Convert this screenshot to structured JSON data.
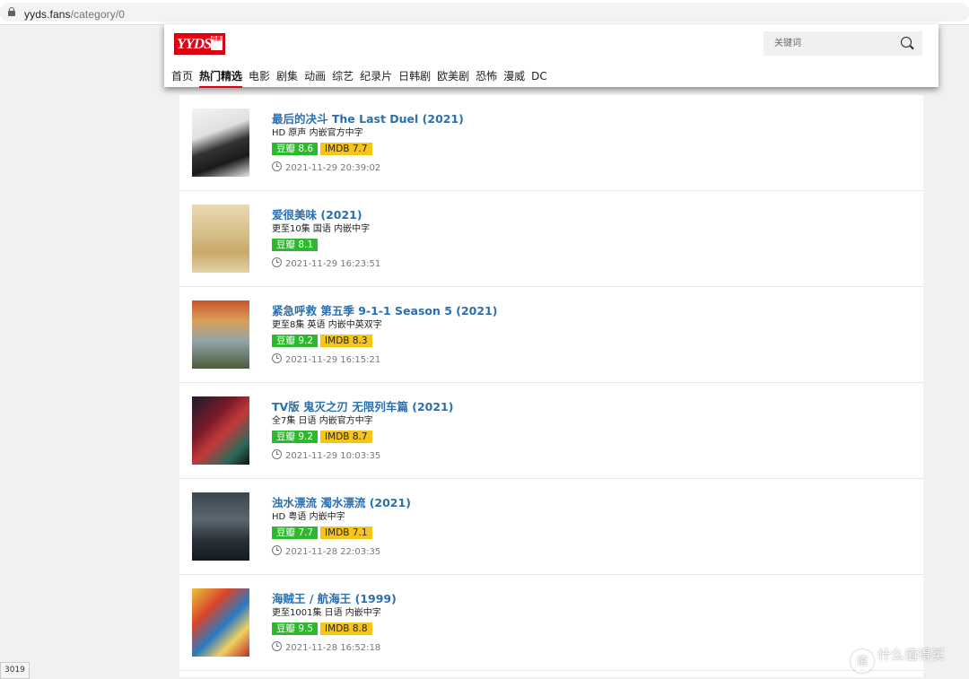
{
  "browser": {
    "url_host": "yyds.fans",
    "url_path": "/category/0"
  },
  "site": {
    "logo_text": "YYDS",
    "logo_sub": "电影",
    "search_placeholder": "关键词"
  },
  "nav": [
    {
      "label": "首页"
    },
    {
      "label": "热门精选",
      "active": true
    },
    {
      "label": "电影"
    },
    {
      "label": "剧集"
    },
    {
      "label": "动画"
    },
    {
      "label": "综艺"
    },
    {
      "label": "纪录片"
    },
    {
      "label": "日韩剧"
    },
    {
      "label": "欧美剧"
    },
    {
      "label": "恐怖"
    },
    {
      "label": "漫威"
    },
    {
      "label": "DC"
    }
  ],
  "items": [
    {
      "title": "最后的决斗 The Last Duel (2021)",
      "subtitle": "HD 原声 内嵌官方中字",
      "douban": "豆瓣 8.6",
      "imdb": "IMDB 7.7",
      "time": "2021-11-29 20:39:02"
    },
    {
      "title": "爱很美味 (2021)",
      "subtitle": "更至10集 国语 内嵌中字",
      "douban": "豆瓣 8.1",
      "imdb": null,
      "time": "2021-11-29 16:23:51"
    },
    {
      "title": "紧急呼救 第五季 9-1-1 Season 5 (2021)",
      "subtitle": "更至8集 英语 内嵌中英双字",
      "douban": "豆瓣 9.2",
      "imdb": "IMDB 8.3",
      "time": "2021-11-29 16:15:21"
    },
    {
      "title": "TV版 鬼灭之刃 无限列车篇 (2021)",
      "subtitle": "全7集 日语 内嵌官方中字",
      "douban": "豆瓣 9.2",
      "imdb": "IMDB 8.7",
      "time": "2021-11-29 10:03:35"
    },
    {
      "title": "浊水漂流 濁水漂流 (2021)",
      "subtitle": "HD 粤语 内嵌中字",
      "douban": "豆瓣 7.7",
      "imdb": "IMDB 7.1",
      "time": "2021-11-28 22:03:35"
    },
    {
      "title": "海贼王 / 航海王 (1999)",
      "subtitle": "更至1001集 日语 内嵌中字",
      "douban": "豆瓣 9.5",
      "imdb": "IMDB 8.8",
      "time": "2021-11-28 16:52:18"
    }
  ],
  "status_text": "3019",
  "watermark": {
    "logo": "值",
    "text": "什么值得买"
  },
  "colors": {
    "accent_red": "#e60012",
    "title_blue": "#2a6fb0",
    "douban_green": "#2eb82e",
    "imdb_yellow": "#f5c518"
  }
}
